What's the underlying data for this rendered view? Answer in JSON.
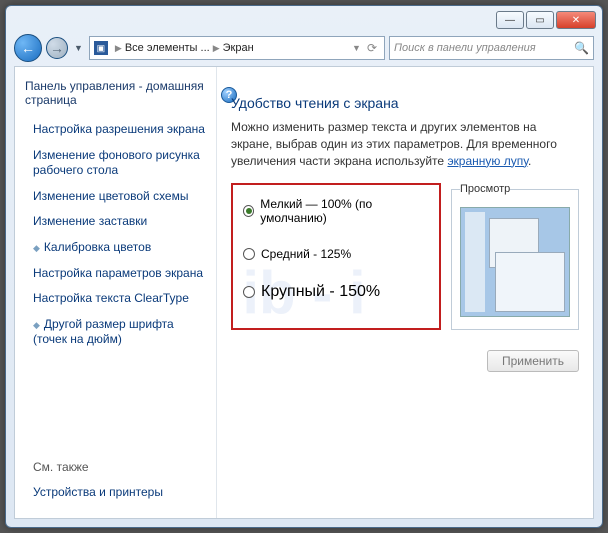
{
  "titlebar": {
    "min": "—",
    "max": "▭",
    "close": "✕"
  },
  "nav": {
    "back": "←",
    "fwd": "→",
    "crumb1": "Все элементы ...",
    "crumb2": "Экран",
    "search_placeholder": "Поиск в панели управления"
  },
  "sidebar": {
    "head": "Панель управления - домашняя страница",
    "links": [
      "Настройка разрешения экрана",
      "Изменение фонового рисунка рабочего стола",
      "Изменение цветовой схемы",
      "Изменение заставки",
      "Калибровка цветов",
      "Настройка параметров экрана",
      "Настройка текста ClearType",
      "Другой размер шрифта (точек на дюйм)"
    ],
    "see_also": "См. также",
    "footer_link": "Устройства и принтеры"
  },
  "main": {
    "title": "Удобство чтения с экрана",
    "desc_pre": "Можно изменить размер текста и других элементов на экране, выбрав один из этих параметров. Для временного увеличения части экрана используйте ",
    "desc_link": "экранную лупу",
    "desc_post": ".",
    "options": [
      {
        "label": "Мелкий — 100% (по умолчанию)",
        "selected": true,
        "large": false
      },
      {
        "label": "Средний - 125%",
        "selected": false,
        "large": false
      },
      {
        "label": "Крупный - 150%",
        "selected": false,
        "large": true
      }
    ],
    "preview_label": "Просмотр",
    "apply": "Применить"
  }
}
